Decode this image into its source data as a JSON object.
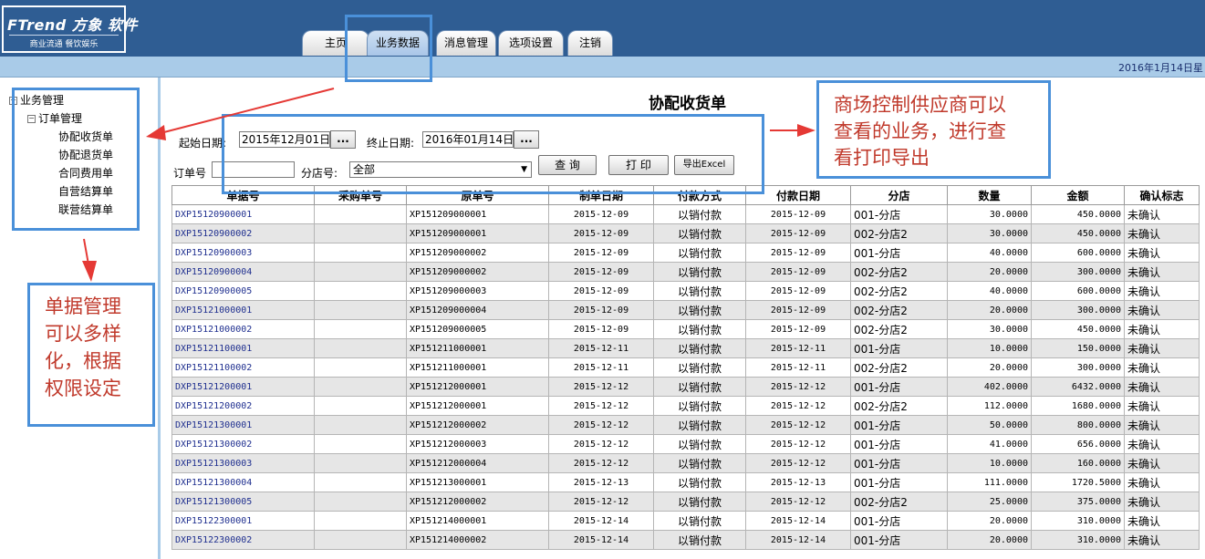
{
  "logo": {
    "brand": "FTrend 方象 软件",
    "slogan": "商业流通  餐饮娱乐"
  },
  "tabs": [
    {
      "label": "主页",
      "active": false
    },
    {
      "label": "业务数据",
      "active": true
    },
    {
      "label": "消息管理",
      "active": false
    },
    {
      "label": "选项设置",
      "active": false
    },
    {
      "label": "注销",
      "active": false
    }
  ],
  "date_display": "2016年1月14日星",
  "sidebar": {
    "root": "业务管理",
    "sub": "订单管理",
    "items": [
      "协配收货单",
      "协配退货单",
      "合同费用单",
      "自营结算单",
      "联营结算单"
    ]
  },
  "page": {
    "title": "协配收货单"
  },
  "filters": {
    "start_label": "起始日期:",
    "start_value": "2015年12月01日",
    "end_label": "终止日期:",
    "end_value": "2016年01月14日",
    "picker_label": "...",
    "order_label": "订单号",
    "order_value": "",
    "shop_label": "分店号:",
    "shop_value": "全部"
  },
  "buttons": {
    "query": "查 询",
    "print": "打 印",
    "export": "导出Excel"
  },
  "table": {
    "columns": [
      "单据号",
      "采购单号",
      "原单号",
      "制单日期",
      "付款方式",
      "付款日期",
      "分店",
      "数量",
      "金额",
      "确认标志"
    ],
    "rows": [
      [
        "DXP15120900001",
        "",
        "XP151209000001",
        "2015-12-09",
        "以销付款",
        "2015-12-09",
        "001-分店",
        "30.0000",
        "450.0000",
        "未确认"
      ],
      [
        "DXP15120900002",
        "",
        "XP151209000001",
        "2015-12-09",
        "以销付款",
        "2015-12-09",
        "002-分店2",
        "30.0000",
        "450.0000",
        "未确认"
      ],
      [
        "DXP15120900003",
        "",
        "XP151209000002",
        "2015-12-09",
        "以销付款",
        "2015-12-09",
        "001-分店",
        "40.0000",
        "600.0000",
        "未确认"
      ],
      [
        "DXP15120900004",
        "",
        "XP151209000002",
        "2015-12-09",
        "以销付款",
        "2015-12-09",
        "002-分店2",
        "20.0000",
        "300.0000",
        "未确认"
      ],
      [
        "DXP15120900005",
        "",
        "XP151209000003",
        "2015-12-09",
        "以销付款",
        "2015-12-09",
        "002-分店2",
        "40.0000",
        "600.0000",
        "未确认"
      ],
      [
        "DXP15121000001",
        "",
        "XP151209000004",
        "2015-12-09",
        "以销付款",
        "2015-12-09",
        "002-分店2",
        "20.0000",
        "300.0000",
        "未确认"
      ],
      [
        "DXP15121000002",
        "",
        "XP151209000005",
        "2015-12-09",
        "以销付款",
        "2015-12-09",
        "002-分店2",
        "30.0000",
        "450.0000",
        "未确认"
      ],
      [
        "DXP15121100001",
        "",
        "XP151211000001",
        "2015-12-11",
        "以销付款",
        "2015-12-11",
        "001-分店",
        "10.0000",
        "150.0000",
        "未确认"
      ],
      [
        "DXP15121100002",
        "",
        "XP151211000001",
        "2015-12-11",
        "以销付款",
        "2015-12-11",
        "002-分店2",
        "20.0000",
        "300.0000",
        "未确认"
      ],
      [
        "DXP15121200001",
        "",
        "XP151212000001",
        "2015-12-12",
        "以销付款",
        "2015-12-12",
        "001-分店",
        "402.0000",
        "6432.0000",
        "未确认"
      ],
      [
        "DXP15121200002",
        "",
        "XP151212000001",
        "2015-12-12",
        "以销付款",
        "2015-12-12",
        "002-分店2",
        "112.0000",
        "1680.0000",
        "未确认"
      ],
      [
        "DXP15121300001",
        "",
        "XP151212000002",
        "2015-12-12",
        "以销付款",
        "2015-12-12",
        "001-分店",
        "50.0000",
        "800.0000",
        "未确认"
      ],
      [
        "DXP15121300002",
        "",
        "XP151212000003",
        "2015-12-12",
        "以销付款",
        "2015-12-12",
        "001-分店",
        "41.0000",
        "656.0000",
        "未确认"
      ],
      [
        "DXP15121300003",
        "",
        "XP151212000004",
        "2015-12-12",
        "以销付款",
        "2015-12-12",
        "001-分店",
        "10.0000",
        "160.0000",
        "未确认"
      ],
      [
        "DXP15121300004",
        "",
        "XP151213000001",
        "2015-12-13",
        "以销付款",
        "2015-12-13",
        "001-分店",
        "111.0000",
        "1720.5000",
        "未确认"
      ],
      [
        "DXP15121300005",
        "",
        "XP151212000002",
        "2015-12-12",
        "以销付款",
        "2015-12-12",
        "002-分店2",
        "25.0000",
        "375.0000",
        "未确认"
      ],
      [
        "DXP15122300001",
        "",
        "XP151214000001",
        "2015-12-14",
        "以销付款",
        "2015-12-14",
        "001-分店",
        "20.0000",
        "310.0000",
        "未确认"
      ],
      [
        "DXP15122300002",
        "",
        "XP151214000002",
        "2015-12-14",
        "以销付款",
        "2015-12-14",
        "001-分店",
        "20.0000",
        "310.0000",
        "未确认"
      ]
    ]
  },
  "annotations": {
    "right_note": [
      "商场控制供应商可以",
      "查看的业务，进行查",
      "看打印导出"
    ],
    "left_note": [
      "单据管理",
      "可以多样",
      "化，根据",
      "权限设定"
    ],
    "arrow_color": "#e53935",
    "box_color": "#4a90d9"
  }
}
